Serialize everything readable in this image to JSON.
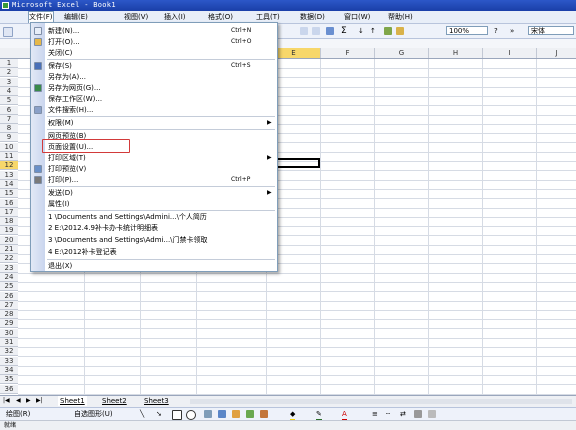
{
  "window": {
    "title": "Microsoft Excel - Book1"
  },
  "menubar": {
    "items": [
      {
        "label": "文件(F)",
        "open": true
      },
      {
        "label": "编辑(E)"
      },
      {
        "label": "视图(V)"
      },
      {
        "label": "插入(I)"
      },
      {
        "label": "格式(O)"
      },
      {
        "label": "工具(T)"
      },
      {
        "label": "数据(D)"
      },
      {
        "label": "窗口(W)"
      },
      {
        "label": "帮助(H)"
      }
    ]
  },
  "toolbar": {
    "sum_symbol": "Σ",
    "zoom": "100%",
    "font_name": "宋体"
  },
  "columns": [
    "E",
    "F",
    "G",
    "H",
    "I",
    "J"
  ],
  "rows": [
    "1",
    "2",
    "3",
    "4",
    "5",
    "6",
    "7",
    "8",
    "9",
    "10",
    "11",
    "12",
    "13",
    "14",
    "15",
    "16",
    "17",
    "18",
    "19",
    "20",
    "21",
    "22",
    "23",
    "24",
    "25",
    "26",
    "27",
    "28",
    "29",
    "30",
    "31",
    "32",
    "33",
    "34",
    "35",
    "36"
  ],
  "file_menu": {
    "items": [
      {
        "label": "新建(N)...",
        "shortcut": "Ctrl+N",
        "icon": "new-icon"
      },
      {
        "label": "打开(O)...",
        "shortcut": "Ctrl+O",
        "icon": "open-icon"
      },
      {
        "label": "关闭(C)"
      },
      {
        "label": "保存(S)",
        "shortcut": "Ctrl+S",
        "icon": "save-icon"
      },
      {
        "label": "另存为(A)..."
      },
      {
        "label": "另存为网页(G)...",
        "icon": "web-icon"
      },
      {
        "label": "保存工作区(W)..."
      },
      {
        "label": "文件搜索(H)...",
        "icon": "search-icon"
      },
      {
        "label": "权限(M)",
        "submenu": true
      },
      {
        "label": "网页预览(B)"
      },
      {
        "label": "页面设置(U)..."
      },
      {
        "label": "打印区域(T)",
        "submenu": true
      },
      {
        "label": "打印预览(V)",
        "icon": "preview-icon"
      },
      {
        "label": "打印(P)...",
        "shortcut": "Ctrl+P",
        "icon": "print-icon"
      },
      {
        "label": "发送(D)",
        "submenu": true
      },
      {
        "label": "属性(I)"
      },
      {
        "label": "1 \\Documents and Settings\\Admini...\\个人简历"
      },
      {
        "label": "2 E:\\2012.4.9补卡办卡统计明细表"
      },
      {
        "label": "3 \\Documents and Settings\\Admi...\\门禁卡领取"
      },
      {
        "label": "4 E:\\2012补卡登记表"
      },
      {
        "label": "退出(X)"
      }
    ]
  },
  "sheets": [
    "Sheet1",
    "Sheet2",
    "Sheet3"
  ],
  "drawing_toolbar": {
    "draw_label": "绘图(R)",
    "autoshapes_label": "自选图形(U)"
  },
  "status": {
    "text": "就绪"
  },
  "colors": {
    "titlebar": "#1a3fa8",
    "highlight_box": "#d23a3a",
    "selected_header": "#f7d76a"
  }
}
